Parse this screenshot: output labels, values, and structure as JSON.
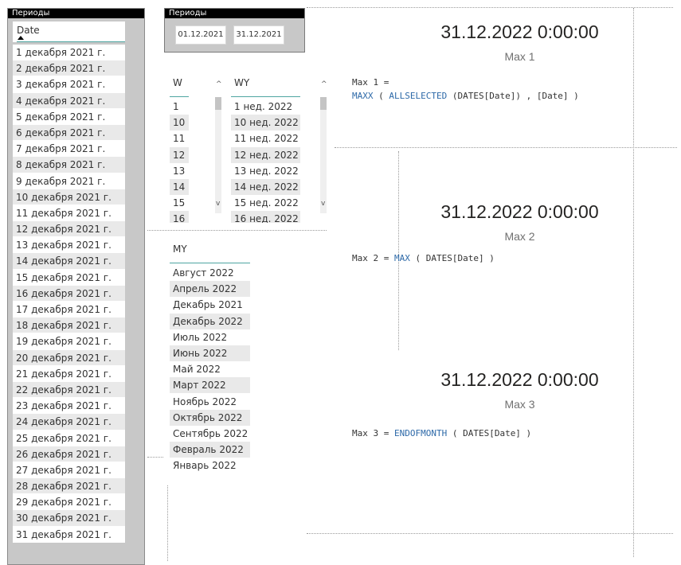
{
  "left_slicer": {
    "title": "Периоды",
    "column_header": "Date",
    "items": [
      "1 декабря 2021 г.",
      "2 декабря 2021 г.",
      "3 декабря 2021 г.",
      "4 декабря 2021 г.",
      "5 декабря 2021 г.",
      "6 декабря 2021 г.",
      "7 декабря 2021 г.",
      "8 декабря 2021 г.",
      "9 декабря 2021 г.",
      "10 декабря 2021 г.",
      "11 декабря 2021 г.",
      "12 декабря 2021 г.",
      "13 декабря 2021 г.",
      "14 декабря 2021 г.",
      "15 декабря 2021 г.",
      "16 декабря 2021 г.",
      "17 декабря 2021 г.",
      "18 декабря 2021 г.",
      "19 декабря 2021 г.",
      "20 декабря 2021 г.",
      "21 декабря 2021 г.",
      "22 декабря 2021 г.",
      "23 декабря 2021 г.",
      "24 декабря 2021 г.",
      "25 декабря 2021 г.",
      "26 декабря 2021 г.",
      "27 декабря 2021 г.",
      "28 декабря 2021 г.",
      "29 декабря 2021 г.",
      "30 декабря 2021 г.",
      "31 декабря 2021 г."
    ]
  },
  "range_slicer": {
    "title": "Периоды",
    "start": "01.12.2021",
    "end": "31.12.2021"
  },
  "w_slicer": {
    "header": "W",
    "items": [
      "1",
      "10",
      "11",
      "12",
      "13",
      "14",
      "15",
      "16"
    ]
  },
  "wy_slicer": {
    "header": "WY",
    "items": [
      "1 нед. 2022",
      "10 нед. 2022",
      "11 нед. 2022",
      "12 нед. 2022",
      "13 нед. 2022",
      "14 нед. 2022",
      "15 нед. 2022",
      "16 нед. 2022"
    ]
  },
  "my_slicer": {
    "header": "MY",
    "items": [
      "Август 2022",
      "Апрель 2022",
      "Декабрь 2021",
      "Декабрь 2022",
      "Июль 2022",
      "Июнь 2022",
      "Май 2022",
      "Март 2022",
      "Ноябрь 2022",
      "Октябрь 2022",
      "Сентябрь 2022",
      "Февраль 2022",
      "Январь 2022"
    ]
  },
  "cards": [
    {
      "value": "31.12.2022 0:00:00",
      "label": "Max 1"
    },
    {
      "value": "31.12.2022 0:00:00",
      "label": "Max 2"
    },
    {
      "value": "31.12.2022 0:00:00",
      "label": "Max 3"
    }
  ],
  "measures": {
    "max1_line1": "Max 1 =",
    "max1_fn1": "MAXX",
    "max1_p1": " ( ",
    "max1_fn2": "ALLSELECTED",
    "max1_p2": " (DATES[Date]) , [Date] )",
    "max2_name": "Max 2 = ",
    "max2_fn": "MAX",
    "max2_rest": " ( DATES[Date] )",
    "max3_name": "Max 3 = ",
    "max3_fn": "ENDOFMONTH",
    "max3_rest": " ( DATES[Date] )"
  },
  "colors": {
    "accent_line": "#4fa5a1",
    "dax_function": "#2d69a8",
    "slicer_bg": "#c8c8c8",
    "header_bg": "#000000"
  },
  "icons": {
    "sort": "sort-ascending-icon",
    "scroll_up": "chevron-up-icon",
    "scroll_down": "chevron-down-icon"
  }
}
